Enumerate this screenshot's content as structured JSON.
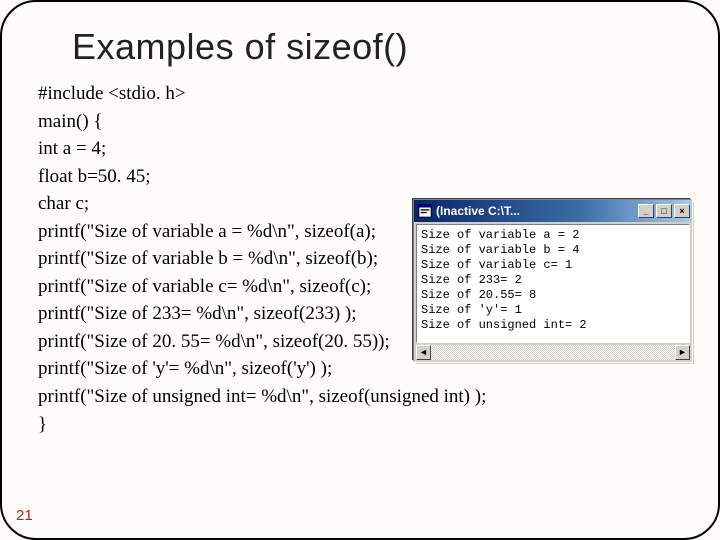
{
  "title": "Examples of sizeof()",
  "code_lines": [
    "#include <stdio. h>",
    "main() {",
    "int a = 4;",
    "float b=50. 45;",
    "char c;",
    "printf(\"Size of variable a = %d\\n\", sizeof(a);",
    "printf(\"Size of variable b = %d\\n\", sizeof(b);",
    "printf(\"Size of variable c= %d\\n\", sizeof(c);",
    "printf(\"Size of 233= %d\\n\", sizeof(233) );",
    "printf(\"Size of 20. 55= %d\\n\", sizeof(20. 55));",
    "printf(\"Size of 'y'= %d\\n\", sizeof('y') );",
    "printf(\"Size of unsigned int= %d\\n\", sizeof(unsigned int) );",
    "}"
  ],
  "page_number": "21",
  "console": {
    "title": "(Inactive C:\\T... ",
    "min_label": "_",
    "max_label": "□",
    "close_label": "×",
    "left_arrow": "◄",
    "right_arrow": "►",
    "output_lines": [
      "Size of variable a = 2",
      "Size of variable b = 4",
      "Size of variable c= 1",
      "Size of 233= 2",
      "Size of 20.55= 8",
      "Size of 'y'= 1",
      "Size of unsigned int= 2"
    ]
  }
}
